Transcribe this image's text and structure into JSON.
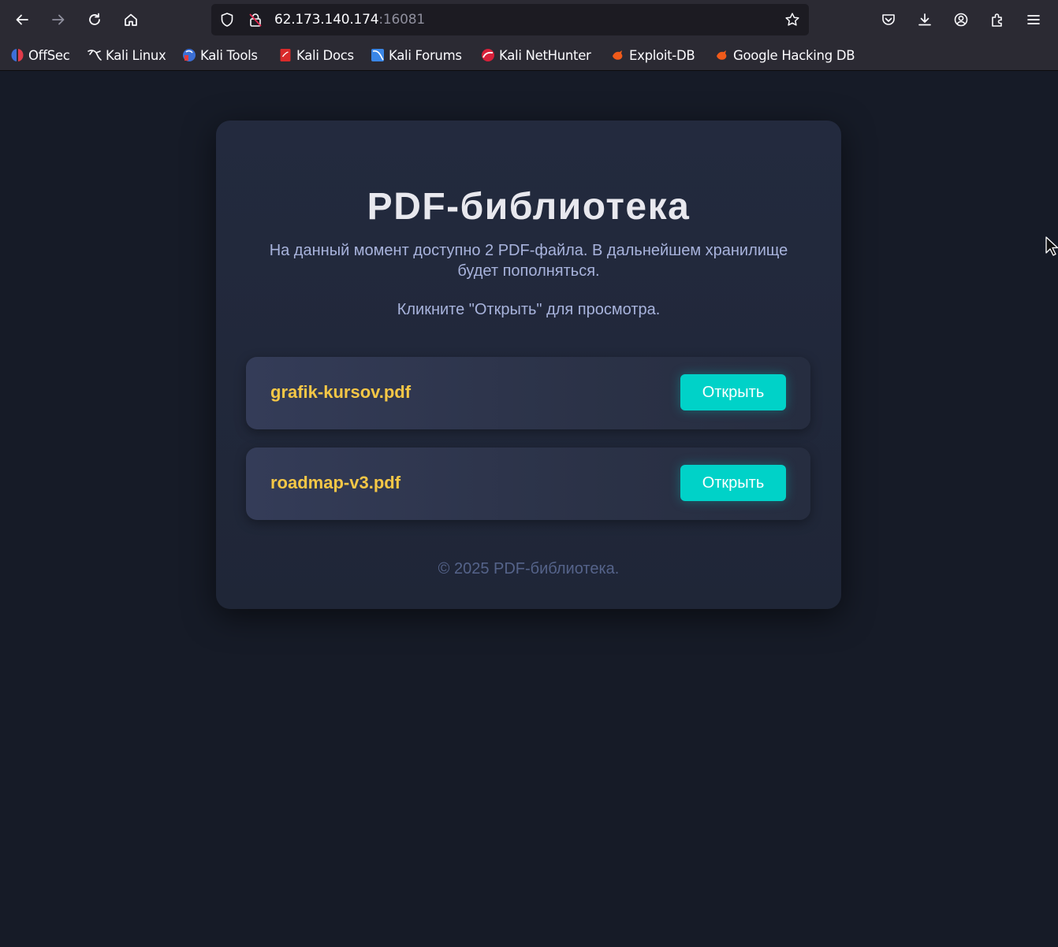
{
  "browser": {
    "url_host": "62.173.140.174",
    "url_port": ":16081",
    "bookmarks": [
      {
        "label": "OffSec",
        "icon": "offsec-icon"
      },
      {
        "label": "Kali Linux",
        "icon": "kali-linux-icon"
      },
      {
        "label": "Kali Tools",
        "icon": "kali-tools-icon"
      },
      {
        "label": "Kali Docs",
        "icon": "kali-docs-icon"
      },
      {
        "label": "Kali Forums",
        "icon": "kali-forums-icon"
      },
      {
        "label": "Kali NetHunter",
        "icon": "kali-nethunter-icon"
      },
      {
        "label": "Exploit-DB",
        "icon": "exploit-db-icon"
      },
      {
        "label": "Google Hacking DB",
        "icon": "ghdb-icon"
      }
    ]
  },
  "page": {
    "title": "PDF-библиотека",
    "description": "На данный момент доступно 2 PDF-файла. В дальнейшем хранилище будет пополняться.",
    "hint": "Кликните \"Открыть\" для просмотра.",
    "files": [
      {
        "name": "grafik-kursov.pdf",
        "button": "Открыть"
      },
      {
        "name": "roadmap-v3.pdf",
        "button": "Открыть"
      }
    ],
    "footer": "© 2025 PDF-библиотека."
  },
  "colors": {
    "background": "#161b27",
    "card": "#232a3e",
    "file_name": "#f5c746",
    "button": "#00d2c8",
    "description": "#a8b3dc"
  }
}
